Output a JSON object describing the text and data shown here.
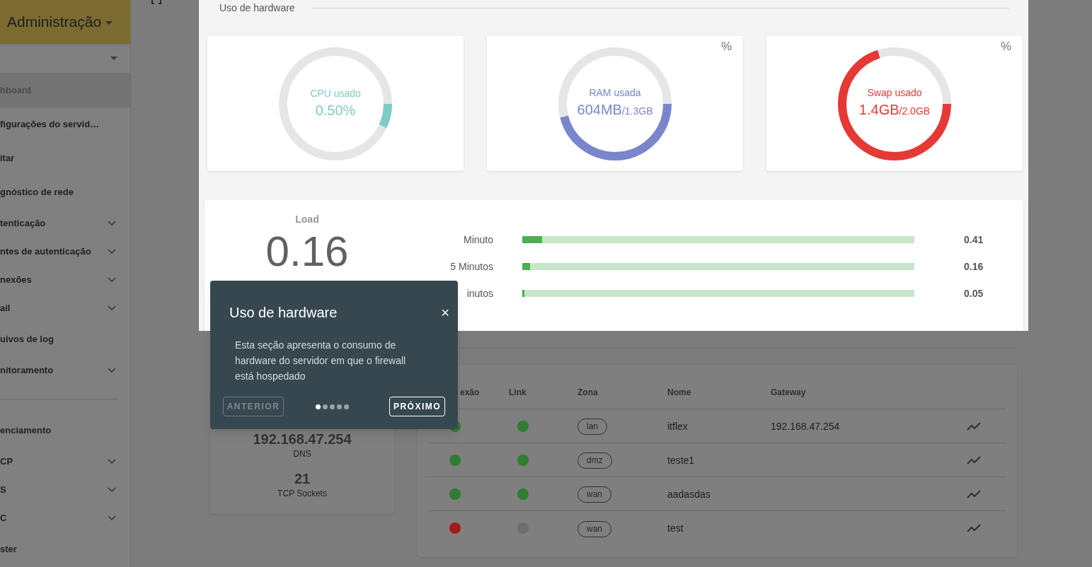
{
  "header": {
    "title": "Administração"
  },
  "sidebar": {
    "sections": [
      [
        {
          "label": "hboard",
          "selected": true,
          "expandable": false
        },
        {
          "label": "figurações do servid…",
          "selected": false,
          "expandable": false
        },
        {
          "label": "itar",
          "selected": false,
          "expandable": false
        },
        {
          "label": "gnóstico de rede",
          "selected": false,
          "expandable": false
        },
        {
          "label": "tenticação",
          "selected": false,
          "expandable": true
        },
        {
          "label": "ntes de autenticação",
          "selected": false,
          "expandable": true
        },
        {
          "label": "nexões",
          "selected": false,
          "expandable": true
        },
        {
          "label": "ail",
          "selected": false,
          "expandable": true
        },
        {
          "label": "uivos de log",
          "selected": false,
          "expandable": false
        },
        {
          "label": "nitoramento",
          "selected": false,
          "expandable": true
        }
      ],
      [
        {
          "label": "enciamento",
          "selected": false,
          "expandable": false
        },
        {
          "label": "CP",
          "selected": false,
          "expandable": true
        },
        {
          "label": "S",
          "selected": false,
          "expandable": true
        },
        {
          "label": "C",
          "selected": false,
          "expandable": true
        },
        {
          "label": "ster",
          "selected": false,
          "expandable": false
        }
      ]
    ]
  },
  "hardware": {
    "title": "Uso de hardware",
    "gauges": [
      {
        "label": "CPU usado",
        "value": "0.50%",
        "level": 0.07,
        "color": "#80cbc4"
      },
      {
        "label": "RAM usada",
        "value": "604MB",
        "total": "/1.3GB",
        "level": 0.46,
        "color": "#7986cb",
        "toggle": "%"
      },
      {
        "label": "Swap usado",
        "value": "1.4GB",
        "total": "/2.0GB",
        "level": 0.7,
        "color": "#e53935",
        "toggle": "%"
      }
    ],
    "load": {
      "title": "Load",
      "value": "0.16",
      "rows": [
        {
          "label": "Minuto",
          "level": 0.05,
          "reading": "0.41"
        },
        {
          "label": "5 Minutos",
          "level": 0.02,
          "reading": "0.16"
        },
        {
          "label": "inutos",
          "level": 0.006,
          "reading": "0.05"
        }
      ]
    }
  },
  "tour": {
    "title": "Uso de hardware",
    "close": "×",
    "body": "Esta seção apresenta o consumo de hardware do servidor em que o firewall está hospedado",
    "back": {
      "label": "ANTERIOR",
      "disabled": true
    },
    "next": {
      "label": "PRÓXIMO",
      "disabled": false
    },
    "steps": [
      {
        "selected": true
      },
      {
        "selected": false
      },
      {
        "selected": false
      },
      {
        "selected": false
      },
      {
        "selected": false
      }
    ]
  },
  "network": {
    "stats": [
      {
        "value": "192.168.47.254",
        "label": "DNS"
      },
      {
        "value": "21",
        "label": "TCP Sockets"
      }
    ],
    "table": {
      "columns": [
        "exão",
        "Link",
        "Zona",
        "Nome",
        "Gateway"
      ],
      "rows": [
        {
          "connection": {
            "color": "#2e7d32"
          },
          "link": {
            "color": "#2e7d32"
          },
          "zone": "lan",
          "name": "itflex",
          "gateway": "192.168.47.254"
        },
        {
          "connection": {
            "color": "#2e7d32"
          },
          "link": {
            "color": "#2e7d32"
          },
          "zone": "dmz",
          "name": "teste1"
        },
        {
          "connection": {
            "color": "#2e7d32"
          },
          "link": {
            "color": "#2e7d32"
          },
          "zone": "wan",
          "name": "aadasdas"
        },
        {
          "connection": {
            "color": "#a11d1d"
          },
          "link": {
            "color": "#6e6e6e"
          },
          "zone": "wan",
          "name": "test"
        }
      ]
    }
  }
}
